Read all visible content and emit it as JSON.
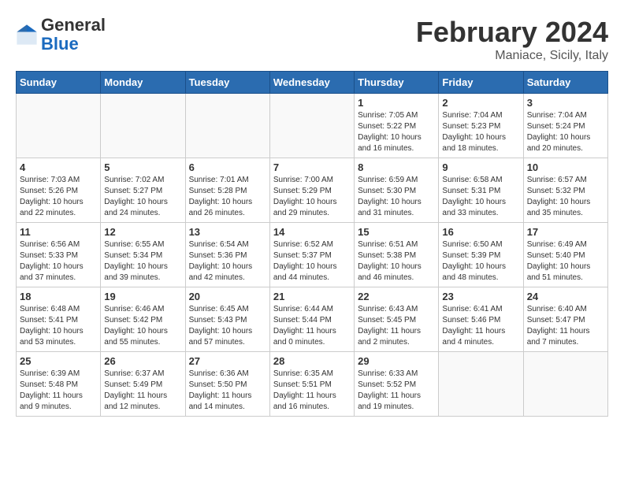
{
  "header": {
    "logo_general": "General",
    "logo_blue": "Blue",
    "month_title": "February 2024",
    "location": "Maniace, Sicily, Italy"
  },
  "weekdays": [
    "Sunday",
    "Monday",
    "Tuesday",
    "Wednesday",
    "Thursday",
    "Friday",
    "Saturday"
  ],
  "weeks": [
    [
      {
        "day": "",
        "empty": true
      },
      {
        "day": "",
        "empty": true
      },
      {
        "day": "",
        "empty": true
      },
      {
        "day": "",
        "empty": true
      },
      {
        "day": "1",
        "sunrise": "Sunrise: 7:05 AM",
        "sunset": "Sunset: 5:22 PM",
        "daylight": "Daylight: 10 hours and 16 minutes."
      },
      {
        "day": "2",
        "sunrise": "Sunrise: 7:04 AM",
        "sunset": "Sunset: 5:23 PM",
        "daylight": "Daylight: 10 hours and 18 minutes."
      },
      {
        "day": "3",
        "sunrise": "Sunrise: 7:04 AM",
        "sunset": "Sunset: 5:24 PM",
        "daylight": "Daylight: 10 hours and 20 minutes."
      }
    ],
    [
      {
        "day": "4",
        "sunrise": "Sunrise: 7:03 AM",
        "sunset": "Sunset: 5:26 PM",
        "daylight": "Daylight: 10 hours and 22 minutes."
      },
      {
        "day": "5",
        "sunrise": "Sunrise: 7:02 AM",
        "sunset": "Sunset: 5:27 PM",
        "daylight": "Daylight: 10 hours and 24 minutes."
      },
      {
        "day": "6",
        "sunrise": "Sunrise: 7:01 AM",
        "sunset": "Sunset: 5:28 PM",
        "daylight": "Daylight: 10 hours and 26 minutes."
      },
      {
        "day": "7",
        "sunrise": "Sunrise: 7:00 AM",
        "sunset": "Sunset: 5:29 PM",
        "daylight": "Daylight: 10 hours and 29 minutes."
      },
      {
        "day": "8",
        "sunrise": "Sunrise: 6:59 AM",
        "sunset": "Sunset: 5:30 PM",
        "daylight": "Daylight: 10 hours and 31 minutes."
      },
      {
        "day": "9",
        "sunrise": "Sunrise: 6:58 AM",
        "sunset": "Sunset: 5:31 PM",
        "daylight": "Daylight: 10 hours and 33 minutes."
      },
      {
        "day": "10",
        "sunrise": "Sunrise: 6:57 AM",
        "sunset": "Sunset: 5:32 PM",
        "daylight": "Daylight: 10 hours and 35 minutes."
      }
    ],
    [
      {
        "day": "11",
        "sunrise": "Sunrise: 6:56 AM",
        "sunset": "Sunset: 5:33 PM",
        "daylight": "Daylight: 10 hours and 37 minutes."
      },
      {
        "day": "12",
        "sunrise": "Sunrise: 6:55 AM",
        "sunset": "Sunset: 5:34 PM",
        "daylight": "Daylight: 10 hours and 39 minutes."
      },
      {
        "day": "13",
        "sunrise": "Sunrise: 6:54 AM",
        "sunset": "Sunset: 5:36 PM",
        "daylight": "Daylight: 10 hours and 42 minutes."
      },
      {
        "day": "14",
        "sunrise": "Sunrise: 6:52 AM",
        "sunset": "Sunset: 5:37 PM",
        "daylight": "Daylight: 10 hours and 44 minutes."
      },
      {
        "day": "15",
        "sunrise": "Sunrise: 6:51 AM",
        "sunset": "Sunset: 5:38 PM",
        "daylight": "Daylight: 10 hours and 46 minutes."
      },
      {
        "day": "16",
        "sunrise": "Sunrise: 6:50 AM",
        "sunset": "Sunset: 5:39 PM",
        "daylight": "Daylight: 10 hours and 48 minutes."
      },
      {
        "day": "17",
        "sunrise": "Sunrise: 6:49 AM",
        "sunset": "Sunset: 5:40 PM",
        "daylight": "Daylight: 10 hours and 51 minutes."
      }
    ],
    [
      {
        "day": "18",
        "sunrise": "Sunrise: 6:48 AM",
        "sunset": "Sunset: 5:41 PM",
        "daylight": "Daylight: 10 hours and 53 minutes."
      },
      {
        "day": "19",
        "sunrise": "Sunrise: 6:46 AM",
        "sunset": "Sunset: 5:42 PM",
        "daylight": "Daylight: 10 hours and 55 minutes."
      },
      {
        "day": "20",
        "sunrise": "Sunrise: 6:45 AM",
        "sunset": "Sunset: 5:43 PM",
        "daylight": "Daylight: 10 hours and 57 minutes."
      },
      {
        "day": "21",
        "sunrise": "Sunrise: 6:44 AM",
        "sunset": "Sunset: 5:44 PM",
        "daylight": "Daylight: 11 hours and 0 minutes."
      },
      {
        "day": "22",
        "sunrise": "Sunrise: 6:43 AM",
        "sunset": "Sunset: 5:45 PM",
        "daylight": "Daylight: 11 hours and 2 minutes."
      },
      {
        "day": "23",
        "sunrise": "Sunrise: 6:41 AM",
        "sunset": "Sunset: 5:46 PM",
        "daylight": "Daylight: 11 hours and 4 minutes."
      },
      {
        "day": "24",
        "sunrise": "Sunrise: 6:40 AM",
        "sunset": "Sunset: 5:47 PM",
        "daylight": "Daylight: 11 hours and 7 minutes."
      }
    ],
    [
      {
        "day": "25",
        "sunrise": "Sunrise: 6:39 AM",
        "sunset": "Sunset: 5:48 PM",
        "daylight": "Daylight: 11 hours and 9 minutes."
      },
      {
        "day": "26",
        "sunrise": "Sunrise: 6:37 AM",
        "sunset": "Sunset: 5:49 PM",
        "daylight": "Daylight: 11 hours and 12 minutes."
      },
      {
        "day": "27",
        "sunrise": "Sunrise: 6:36 AM",
        "sunset": "Sunset: 5:50 PM",
        "daylight": "Daylight: 11 hours and 14 minutes."
      },
      {
        "day": "28",
        "sunrise": "Sunrise: 6:35 AM",
        "sunset": "Sunset: 5:51 PM",
        "daylight": "Daylight: 11 hours and 16 minutes."
      },
      {
        "day": "29",
        "sunrise": "Sunrise: 6:33 AM",
        "sunset": "Sunset: 5:52 PM",
        "daylight": "Daylight: 11 hours and 19 minutes."
      },
      {
        "day": "",
        "empty": true
      },
      {
        "day": "",
        "empty": true
      }
    ]
  ]
}
